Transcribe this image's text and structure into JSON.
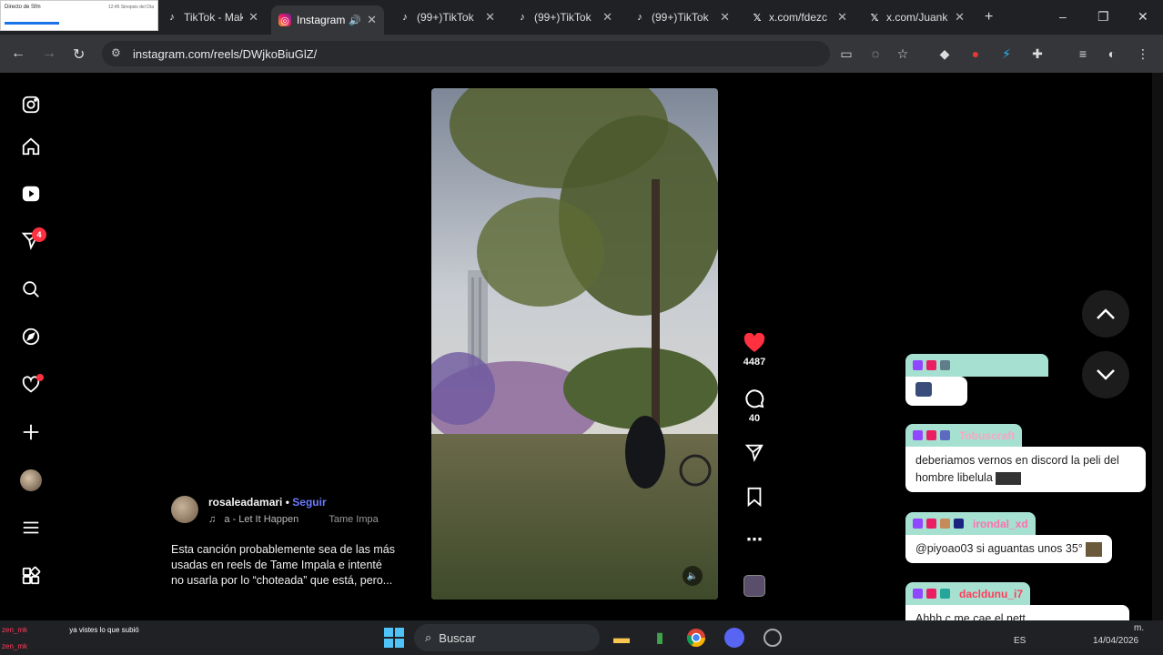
{
  "browser": {
    "preview_title": "Directo de Sfm",
    "preview_meta": "12:45 Sinopsis del Día",
    "tabs": [
      {
        "title": "TikTok - Mak",
        "icon": "tiktok-icon"
      },
      {
        "title": "Instagram",
        "icon": "instagram-icon",
        "active": true
      },
      {
        "title": "(99+)TikTok",
        "icon": "tiktok-icon"
      },
      {
        "title": "(99+)TikTok",
        "icon": "tiktok-icon"
      },
      {
        "title": "(99+)TikTok",
        "icon": "tiktok-icon"
      },
      {
        "title": "x.com/fdezc",
        "icon": "x-icon"
      },
      {
        "title": "x.com/Juank",
        "icon": "x-icon"
      }
    ],
    "url": "instagram.com/reels/DWjkoBiuGlZ/"
  },
  "sidebar": {
    "notifications_badge": "4",
    "items": [
      "instagram-logo-icon",
      "home-icon",
      "reels-icon",
      "direct-icon",
      "search-icon",
      "explore-icon",
      "notifications-icon",
      "create-icon",
      "profile-avatar",
      "menu-icon",
      "apps-icon"
    ]
  },
  "reel": {
    "author": "rosaleadamari",
    "separator": "•",
    "follow_label": "Seguir",
    "audio_text": "a - Let It Happen",
    "audio_artist": "Tame Impa",
    "caption_lines": [
      "Esta canción probablemente sea de las más",
      "usadas en reels de Tame Impala e intenté",
      "no usarla por lo “choteada” que está, pero..."
    ],
    "likes": "4487",
    "comments": "40"
  },
  "chat": [
    {
      "user": "",
      "user_color": "#2ecc71",
      "message": ""
    },
    {
      "user": "Tobuscraft",
      "user_color": "#f7a6c2",
      "message": "deberiamos vernos en discord la peli del hombre libelula"
    },
    {
      "user": "irondal_xd",
      "user_color": "#ff6fae",
      "message": "@piyoao03 si aguantas unos 35°"
    },
    {
      "user": "dacldunu_i7",
      "user_color": "#ff3c5a",
      "message": "Ahhh c me cae el nett"
    }
  ],
  "stream_chat_bottom": [
    {
      "user": "zen_mk",
      "message": "ya vistes lo que subió"
    },
    {
      "user": "zen_mk",
      "message": ""
    }
  ],
  "taskbar": {
    "search_label": "Buscar",
    "language": "ES",
    "time_suffix": "m.",
    "date": "14/04/2026"
  },
  "colors": {
    "like": "#ff3040",
    "follow": "#6c7bff",
    "chat_header": "#a6e0d0"
  }
}
